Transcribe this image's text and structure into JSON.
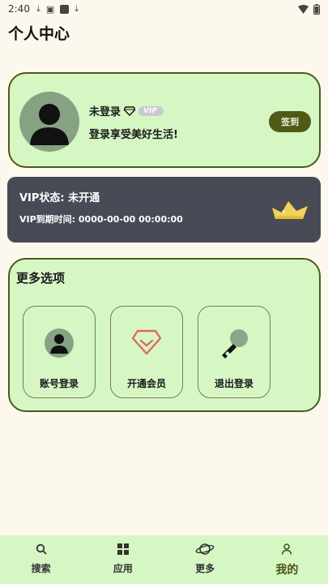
{
  "status_bar": {
    "time": "2:40"
  },
  "page": {
    "title": "个人中心"
  },
  "profile": {
    "username": "未登录",
    "vip_badge": "VIP",
    "slogan": "登录享受美好生活!",
    "signin_label": "签到"
  },
  "vip": {
    "status": "VIP状态: 未开通",
    "expire": "VIP到期时间: 0000-00-00 00:00:00"
  },
  "options": {
    "title": "更多选项",
    "items": [
      {
        "label": "账号登录",
        "icon": "user-avatar-icon"
      },
      {
        "label": "开通会员",
        "icon": "diamond-icon"
      },
      {
        "label": "退出登录",
        "icon": "key-icon"
      }
    ]
  },
  "nav": {
    "items": [
      {
        "label": "搜索",
        "icon": "search-icon"
      },
      {
        "label": "应用",
        "icon": "apps-icon"
      },
      {
        "label": "更多",
        "icon": "planet-icon"
      },
      {
        "label": "我的",
        "icon": "person-icon"
      }
    ],
    "active_index": 3
  },
  "colors": {
    "card_bg": "#d6f7c4",
    "card_border": "#4a5a1a",
    "vip_card_bg": "#484b55",
    "accent": "#4f5a17",
    "page_bg": "#fdf8ee"
  }
}
